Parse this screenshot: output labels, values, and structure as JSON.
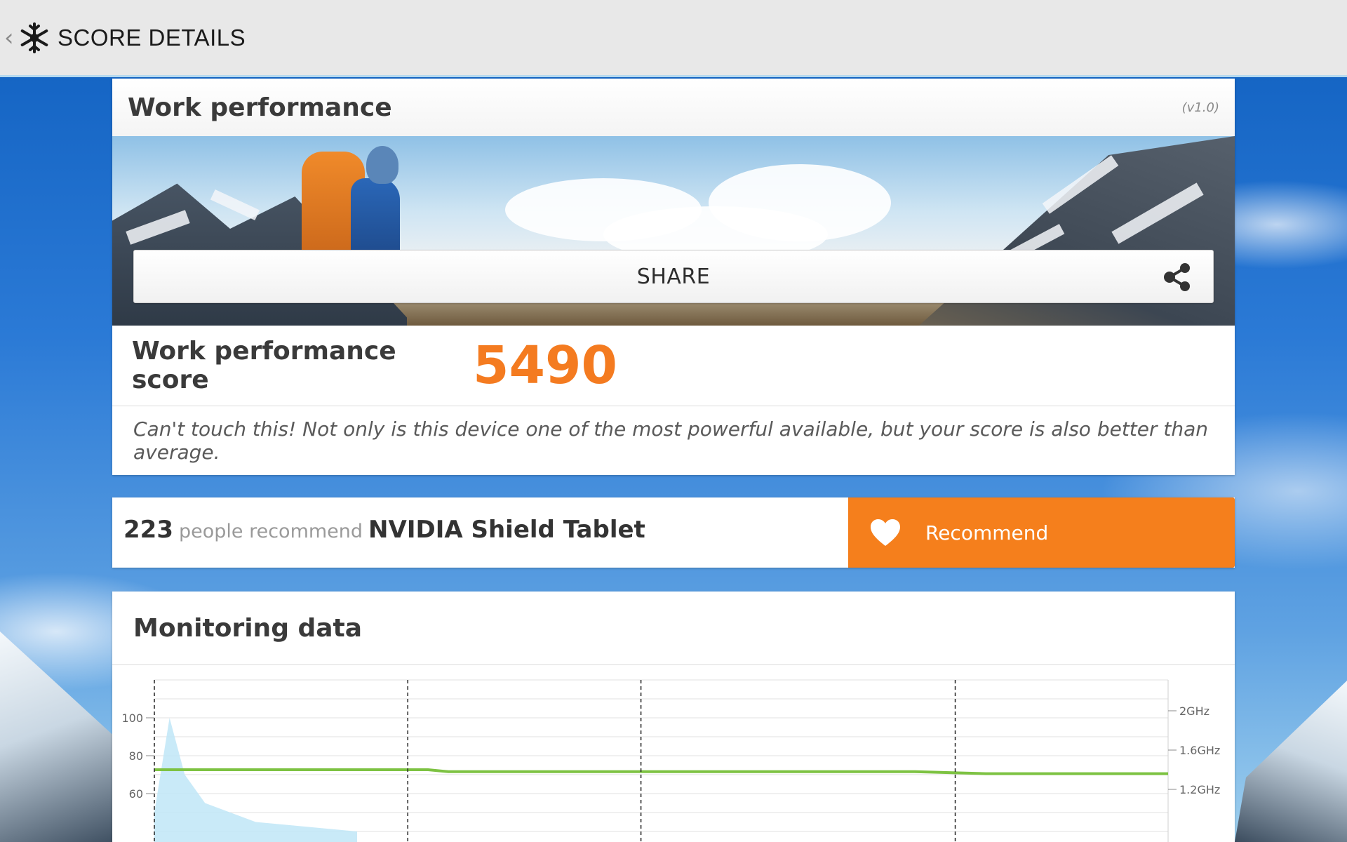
{
  "topbar": {
    "title": "SCORE DETAILS",
    "back_icon": "chevron-left-icon",
    "app_icon": "snowflake-icon"
  },
  "work": {
    "title": "Work performance",
    "version": "(v1.0)",
    "share_label": "SHARE",
    "share_icon": "share-icon",
    "score_label": "Work performance score",
    "score_value": "5490",
    "comment": "Can't touch this! Not only is this device one of the most powerful available, but your score is also better than average."
  },
  "recommend": {
    "count": "223",
    "text": "people recommend",
    "device": "NVIDIA Shield Tablet",
    "button_label": "Recommend",
    "button_icon": "heart-icon"
  },
  "monitoring": {
    "title": "Monitoring data"
  },
  "colors": {
    "accent": "#f47b20",
    "button": "#f57f1c",
    "frequency_line": "#7dc242",
    "load_fill": "#bfe6f7"
  },
  "chart_data": {
    "type": "line",
    "left_axis": {
      "ticks": [
        60,
        80,
        100
      ],
      "tick_labels": [
        "60",
        "80",
        "100"
      ]
    },
    "right_axis": {
      "ticks": [
        1.2,
        1.6,
        2.0
      ],
      "tick_labels": [
        "1.2GHz",
        "1.6GHz",
        "2GHz"
      ]
    },
    "grid": true,
    "series": [
      {
        "axis": "right",
        "color": "#7dc242",
        "x": [
          0,
          0.27,
          0.29,
          0.5,
          0.75,
          0.82,
          1.0
        ],
        "y": [
          1.4,
          1.4,
          1.38,
          1.38,
          1.38,
          1.36,
          1.36
        ]
      },
      {
        "axis": "left",
        "color": "#bfe6f7",
        "x": [
          0,
          0.015,
          0.03,
          0.05,
          0.1,
          0.2
        ],
        "y": [
          50,
          100,
          70,
          55,
          45,
          40
        ]
      }
    ],
    "markers_x": [
      0,
      0.25,
      0.48,
      0.79
    ]
  }
}
